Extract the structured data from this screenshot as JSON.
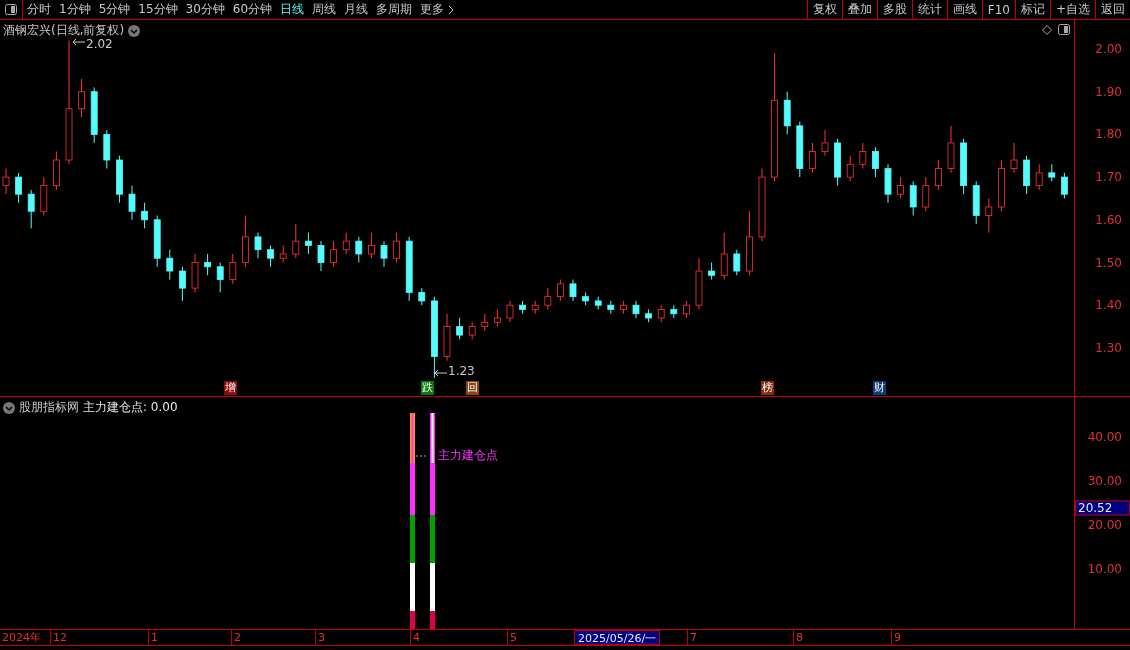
{
  "toolbar": {
    "periods": [
      {
        "label": "分时",
        "selected": false
      },
      {
        "label": "1分钟",
        "selected": false
      },
      {
        "label": "5分钟",
        "selected": false
      },
      {
        "label": "15分钟",
        "selected": false
      },
      {
        "label": "30分钟",
        "selected": false
      },
      {
        "label": "60分钟",
        "selected": false
      },
      {
        "label": "日线",
        "selected": true
      },
      {
        "label": "周线",
        "selected": false
      },
      {
        "label": "月线",
        "selected": false
      },
      {
        "label": "多周期",
        "selected": false
      }
    ],
    "more": "更多",
    "actions": [
      "复权",
      "叠加",
      "多股",
      "统计",
      "画线",
      "F10",
      "标记",
      "+自选",
      "返回"
    ]
  },
  "price_chart": {
    "title": "酒钢宏兴(日线,前复权)",
    "high_label": "2.02",
    "low_label": "1.23",
    "events": [
      {
        "label": "增",
        "color": "#8b0a0a"
      },
      {
        "label": "跌",
        "color": "#0a7a0a"
      },
      {
        "label": "回",
        "color": "#8b4513"
      },
      {
        "label": "榜",
        "color": "#8b2a0a"
      },
      {
        "label": "财",
        "color": "#0a3a7a"
      }
    ],
    "y_ticks": [
      "2.00",
      "1.90",
      "1.80",
      "1.70",
      "1.60",
      "1.50",
      "1.40",
      "1.30"
    ],
    "chart_data": {
      "type": "candlestick",
      "ohlc": [
        [
          1.68,
          1.72,
          1.66,
          1.7
        ],
        [
          1.7,
          1.71,
          1.64,
          1.66
        ],
        [
          1.66,
          1.67,
          1.58,
          1.62
        ],
        [
          1.62,
          1.7,
          1.61,
          1.68
        ],
        [
          1.68,
          1.76,
          1.67,
          1.74
        ],
        [
          1.74,
          2.02,
          1.73,
          1.86
        ],
        [
          1.86,
          1.93,
          1.84,
          1.9
        ],
        [
          1.9,
          1.91,
          1.78,
          1.8
        ],
        [
          1.8,
          1.81,
          1.72,
          1.74
        ],
        [
          1.74,
          1.75,
          1.64,
          1.66
        ],
        [
          1.66,
          1.68,
          1.6,
          1.62
        ],
        [
          1.62,
          1.64,
          1.58,
          1.6
        ],
        [
          1.6,
          1.61,
          1.49,
          1.51
        ],
        [
          1.51,
          1.53,
          1.46,
          1.48
        ],
        [
          1.48,
          1.49,
          1.41,
          1.44
        ],
        [
          1.44,
          1.52,
          1.43,
          1.5
        ],
        [
          1.5,
          1.52,
          1.47,
          1.49
        ],
        [
          1.49,
          1.5,
          1.43,
          1.46
        ],
        [
          1.46,
          1.52,
          1.45,
          1.5
        ],
        [
          1.5,
          1.61,
          1.49,
          1.56
        ],
        [
          1.56,
          1.57,
          1.51,
          1.53
        ],
        [
          1.53,
          1.54,
          1.49,
          1.51
        ],
        [
          1.51,
          1.54,
          1.5,
          1.52
        ],
        [
          1.52,
          1.59,
          1.51,
          1.55
        ],
        [
          1.55,
          1.57,
          1.52,
          1.54
        ],
        [
          1.54,
          1.55,
          1.48,
          1.5
        ],
        [
          1.5,
          1.55,
          1.49,
          1.53
        ],
        [
          1.53,
          1.57,
          1.52,
          1.55
        ],
        [
          1.55,
          1.56,
          1.5,
          1.52
        ],
        [
          1.52,
          1.57,
          1.51,
          1.54
        ],
        [
          1.54,
          1.55,
          1.49,
          1.51
        ],
        [
          1.51,
          1.57,
          1.5,
          1.55
        ],
        [
          1.55,
          1.56,
          1.41,
          1.43
        ],
        [
          1.43,
          1.44,
          1.4,
          1.41
        ],
        [
          1.41,
          1.42,
          1.23,
          1.28
        ],
        [
          1.28,
          1.38,
          1.27,
          1.35
        ],
        [
          1.35,
          1.37,
          1.32,
          1.33
        ],
        [
          1.33,
          1.36,
          1.32,
          1.35
        ],
        [
          1.35,
          1.38,
          1.34,
          1.36
        ],
        [
          1.36,
          1.39,
          1.35,
          1.37
        ],
        [
          1.37,
          1.41,
          1.36,
          1.4
        ],
        [
          1.4,
          1.41,
          1.38,
          1.39
        ],
        [
          1.39,
          1.41,
          1.38,
          1.4
        ],
        [
          1.4,
          1.44,
          1.39,
          1.42
        ],
        [
          1.42,
          1.46,
          1.41,
          1.45
        ],
        [
          1.45,
          1.46,
          1.41,
          1.42
        ],
        [
          1.42,
          1.43,
          1.4,
          1.41
        ],
        [
          1.41,
          1.42,
          1.39,
          1.4
        ],
        [
          1.4,
          1.41,
          1.38,
          1.39
        ],
        [
          1.39,
          1.41,
          1.38,
          1.4
        ],
        [
          1.4,
          1.41,
          1.37,
          1.38
        ],
        [
          1.38,
          1.39,
          1.36,
          1.37
        ],
        [
          1.37,
          1.4,
          1.36,
          1.39
        ],
        [
          1.39,
          1.4,
          1.37,
          1.38
        ],
        [
          1.38,
          1.41,
          1.37,
          1.4
        ],
        [
          1.4,
          1.51,
          1.39,
          1.48
        ],
        [
          1.48,
          1.5,
          1.46,
          1.47
        ],
        [
          1.47,
          1.57,
          1.46,
          1.52
        ],
        [
          1.52,
          1.53,
          1.47,
          1.48
        ],
        [
          1.48,
          1.62,
          1.47,
          1.56
        ],
        [
          1.56,
          1.72,
          1.55,
          1.7
        ],
        [
          1.7,
          1.99,
          1.69,
          1.88
        ],
        [
          1.88,
          1.9,
          1.8,
          1.82
        ],
        [
          1.82,
          1.83,
          1.7,
          1.72
        ],
        [
          1.72,
          1.78,
          1.71,
          1.76
        ],
        [
          1.76,
          1.81,
          1.75,
          1.78
        ],
        [
          1.78,
          1.79,
          1.68,
          1.7
        ],
        [
          1.7,
          1.75,
          1.69,
          1.73
        ],
        [
          1.73,
          1.78,
          1.72,
          1.76
        ],
        [
          1.76,
          1.77,
          1.7,
          1.72
        ],
        [
          1.72,
          1.73,
          1.64,
          1.66
        ],
        [
          1.66,
          1.7,
          1.65,
          1.68
        ],
        [
          1.68,
          1.69,
          1.61,
          1.63
        ],
        [
          1.63,
          1.7,
          1.62,
          1.68
        ],
        [
          1.68,
          1.74,
          1.67,
          1.72
        ],
        [
          1.72,
          1.82,
          1.71,
          1.78
        ],
        [
          1.78,
          1.79,
          1.66,
          1.68
        ],
        [
          1.68,
          1.69,
          1.59,
          1.61
        ],
        [
          1.61,
          1.65,
          1.57,
          1.63
        ],
        [
          1.63,
          1.74,
          1.62,
          1.72
        ],
        [
          1.72,
          1.78,
          1.71,
          1.74
        ],
        [
          1.74,
          1.75,
          1.66,
          1.68
        ],
        [
          1.68,
          1.73,
          1.67,
          1.71
        ],
        [
          1.71,
          1.73,
          1.69,
          1.7
        ],
        [
          1.7,
          1.71,
          1.65,
          1.66
        ]
      ]
    }
  },
  "indicator": {
    "source": "股朋指标网",
    "reading": "主力建仓点: 0.00",
    "signal_label": "主力建仓点",
    "y_ticks": [
      "40.00",
      "30.00",
      "20.00",
      "10.00"
    ],
    "cursor_value": "20.52"
  },
  "date_axis": {
    "year": "2024年",
    "months": [
      "12",
      "1",
      "2",
      "3",
      "4",
      "5",
      "7",
      "8",
      "9"
    ],
    "cursor_date": "2025/05/26/一"
  }
}
